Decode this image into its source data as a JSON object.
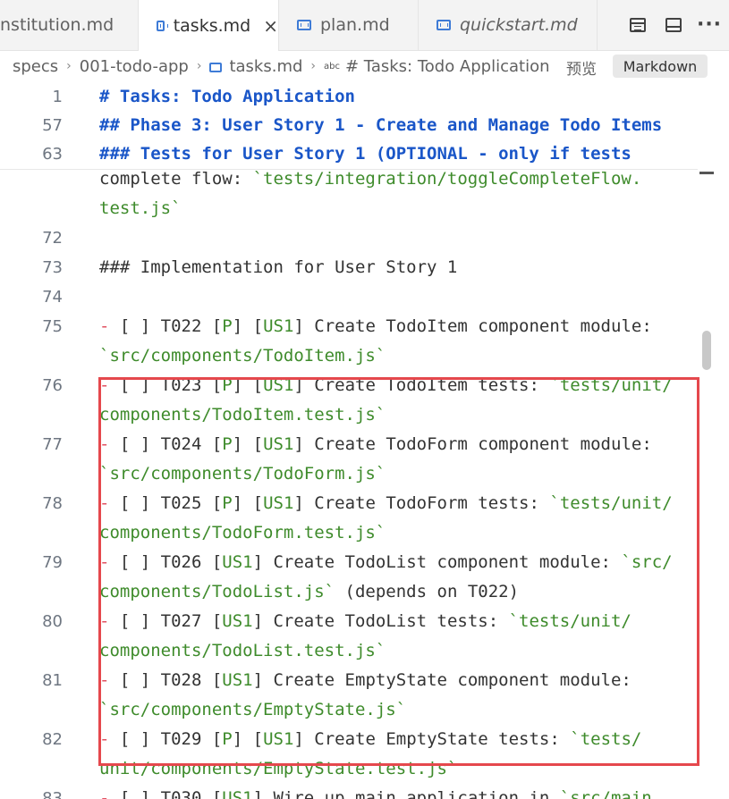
{
  "tabs": [
    {
      "label": "nstitution.md",
      "active": false,
      "italic": false
    },
    {
      "label": "tasks.md",
      "active": true,
      "italic": false
    },
    {
      "label": "plan.md",
      "active": false,
      "italic": false
    },
    {
      "label": "quickstart.md",
      "active": false,
      "italic": true
    }
  ],
  "tab_close_glyph": "×",
  "actions": [
    {
      "name": "open-preview-icon"
    },
    {
      "name": "toggle-panel-icon"
    },
    {
      "name": "more-actions-icon",
      "glyph": "···"
    }
  ],
  "breadcrumb": {
    "items": [
      "specs",
      "001-todo-app",
      "tasks.md",
      "# Tasks: Todo Application"
    ],
    "abc_glyph": "abc",
    "separator": "›"
  },
  "preview_label": "预览",
  "language_button": "Markdown",
  "sticky_lines": [
    {
      "num": "1",
      "text": "# Tasks: Todo Application"
    },
    {
      "num": "57",
      "text": "## Phase 3: User Story 1 - Create and Manage Todo Items"
    },
    {
      "num": "63",
      "text": "### Tests for User Story 1 (OPTIONAL - only if tests"
    }
  ],
  "lines": [
    {
      "num": "",
      "parts": [
        {
          "t": "complete flow: "
        },
        {
          "t": "`tests/integration/toggleCompleteFlow.",
          "c": "cd"
        }
      ]
    },
    {
      "num": "",
      "parts": [
        {
          "t": "test.js`",
          "c": "cd"
        }
      ]
    },
    {
      "num": "72",
      "parts": []
    },
    {
      "num": "73",
      "parts": [
        {
          "t": "### Implementation for User Story 1",
          "c": "h3"
        }
      ]
    },
    {
      "num": "74",
      "parts": []
    },
    {
      "num": "75",
      "parts": [
        {
          "t": "- ",
          "c": "dash"
        },
        {
          "t": "[ ] T022 ["
        },
        {
          "t": "P",
          "c": "tag"
        },
        {
          "t": "] ["
        },
        {
          "t": "US1",
          "c": "tag"
        },
        {
          "t": "] Create TodoItem component module:"
        }
      ]
    },
    {
      "num": "",
      "parts": [
        {
          "t": "`src/components/TodoItem.js`",
          "c": "cd"
        }
      ]
    },
    {
      "num": "76",
      "parts": [
        {
          "t": "- ",
          "c": "dash"
        },
        {
          "t": "[ ] T023 ["
        },
        {
          "t": "P",
          "c": "tag"
        },
        {
          "t": "] ["
        },
        {
          "t": "US1",
          "c": "tag"
        },
        {
          "t": "] Create TodoItem tests: "
        },
        {
          "t": "`tests/unit/",
          "c": "cd"
        }
      ]
    },
    {
      "num": "",
      "parts": [
        {
          "t": "components/TodoItem.test.js`",
          "c": "cd"
        }
      ]
    },
    {
      "num": "77",
      "parts": [
        {
          "t": "- ",
          "c": "dash"
        },
        {
          "t": "[ ] T024 ["
        },
        {
          "t": "P",
          "c": "tag"
        },
        {
          "t": "] ["
        },
        {
          "t": "US1",
          "c": "tag"
        },
        {
          "t": "] Create TodoForm component module:"
        }
      ]
    },
    {
      "num": "",
      "parts": [
        {
          "t": "`src/components/TodoForm.js`",
          "c": "cd"
        }
      ]
    },
    {
      "num": "78",
      "parts": [
        {
          "t": "- ",
          "c": "dash"
        },
        {
          "t": "[ ] T025 ["
        },
        {
          "t": "P",
          "c": "tag"
        },
        {
          "t": "] ["
        },
        {
          "t": "US1",
          "c": "tag"
        },
        {
          "t": "] Create TodoForm tests: "
        },
        {
          "t": "`tests/unit/",
          "c": "cd"
        }
      ]
    },
    {
      "num": "",
      "parts": [
        {
          "t": "components/TodoForm.test.js`",
          "c": "cd"
        }
      ]
    },
    {
      "num": "79",
      "parts": [
        {
          "t": "- ",
          "c": "dash"
        },
        {
          "t": "[ ] T026 ["
        },
        {
          "t": "US1",
          "c": "tag"
        },
        {
          "t": "] Create TodoList component module: "
        },
        {
          "t": "`src/",
          "c": "cd"
        }
      ]
    },
    {
      "num": "",
      "parts": [
        {
          "t": "components/TodoList.js`",
          "c": "cd"
        },
        {
          "t": " (depends on T022)"
        }
      ]
    },
    {
      "num": "80",
      "parts": [
        {
          "t": "- ",
          "c": "dash"
        },
        {
          "t": "[ ] T027 ["
        },
        {
          "t": "US1",
          "c": "tag"
        },
        {
          "t": "] Create TodoList tests: "
        },
        {
          "t": "`tests/unit/",
          "c": "cd"
        }
      ]
    },
    {
      "num": "",
      "parts": [
        {
          "t": "components/TodoList.test.js`",
          "c": "cd"
        }
      ]
    },
    {
      "num": "81",
      "parts": [
        {
          "t": "- ",
          "c": "dash"
        },
        {
          "t": "[ ] T028 ["
        },
        {
          "t": "US1",
          "c": "tag"
        },
        {
          "t": "] Create EmptyState component module:"
        }
      ]
    },
    {
      "num": "",
      "parts": [
        {
          "t": "`src/components/EmptyState.js`",
          "c": "cd"
        }
      ]
    },
    {
      "num": "82",
      "parts": [
        {
          "t": "- ",
          "c": "dash"
        },
        {
          "t": "[ ] T029 ["
        },
        {
          "t": "P",
          "c": "tag"
        },
        {
          "t": "] ["
        },
        {
          "t": "US1",
          "c": "tag"
        },
        {
          "t": "] Create EmptyState tests: "
        },
        {
          "t": "`tests/",
          "c": "cd"
        }
      ]
    },
    {
      "num": "",
      "parts": [
        {
          "t": "unit/components/EmptyState.test.js`",
          "c": "cd"
        }
      ]
    },
    {
      "num": "83",
      "parts": [
        {
          "t": "- ",
          "c": "dash"
        },
        {
          "t": "[ ] T030 ["
        },
        {
          "t": "US1",
          "c": "tag"
        },
        {
          "t": "] Wire up main application in "
        },
        {
          "t": "`src/main",
          "c": "cd"
        }
      ]
    }
  ],
  "colors": {
    "heading": "#1a56c8",
    "code": "#3e8b2b",
    "list_marker": "#e05060",
    "highlight_box": "#e5484d"
  }
}
